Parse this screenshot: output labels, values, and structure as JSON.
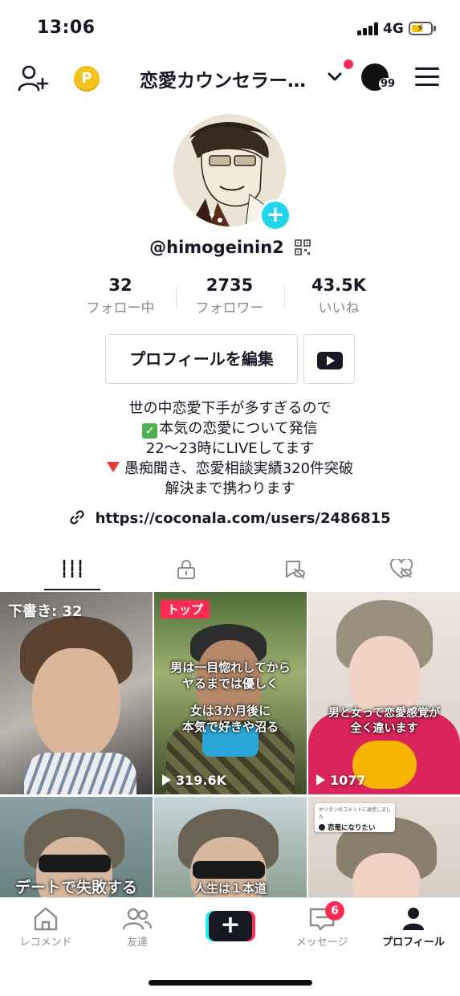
{
  "status_bar": {
    "time": "13:06",
    "network": "4G"
  },
  "top_nav": {
    "account_name": "恋愛カウンセラー…",
    "coin_symbol": "P",
    "switch_count": "99"
  },
  "profile": {
    "username": "@himogeinin2",
    "stats": [
      {
        "value": "32",
        "label": "フォロー中"
      },
      {
        "value": "2735",
        "label": "フォロワー"
      },
      {
        "value": "43.5K",
        "label": "いいね"
      }
    ],
    "edit_button": "プロフィールを編集",
    "bio": {
      "line1": "世の中恋愛下手が多すぎるので",
      "line2": "本気の恋愛について発信",
      "line3": "22〜23時にLIVEしてます",
      "line4": "愚痴聞き、恋愛相談実績320件突破",
      "line5": "解決まで携わります"
    },
    "link": "https://coconala.com/users/2486815"
  },
  "videos": [
    {
      "draft_label": "下書き: 32"
    },
    {
      "badge": "トップ",
      "overlay_1": "男は一目惚れしてから",
      "overlay_2": "ヤるまでは優しく",
      "overlay_3": "女は3か月後に",
      "overlay_4": "本気で好きや沼る",
      "views": "319.6K"
    },
    {
      "overlay_1": "男と女って恋愛感覚が",
      "overlay_2": "全く違います",
      "views": "1077"
    },
    {
      "overlay_1": "デートで失敗する"
    },
    {
      "overlay_1": "人生は１本道"
    },
    {
      "comment_small": "ホリタンのコメントに返信しました",
      "comment_main": "恋竜になりたい"
    }
  ],
  "bottom_nav": {
    "items": [
      {
        "label": "レコメンド"
      },
      {
        "label": "友達"
      },
      {
        "label": "メッセージ",
        "badge": "6"
      },
      {
        "label": "プロフィール"
      }
    ]
  },
  "colors": {
    "accent": "#fe2c55",
    "cyan": "#25f4ee",
    "text": "#161823",
    "muted": "#8a8b91"
  }
}
